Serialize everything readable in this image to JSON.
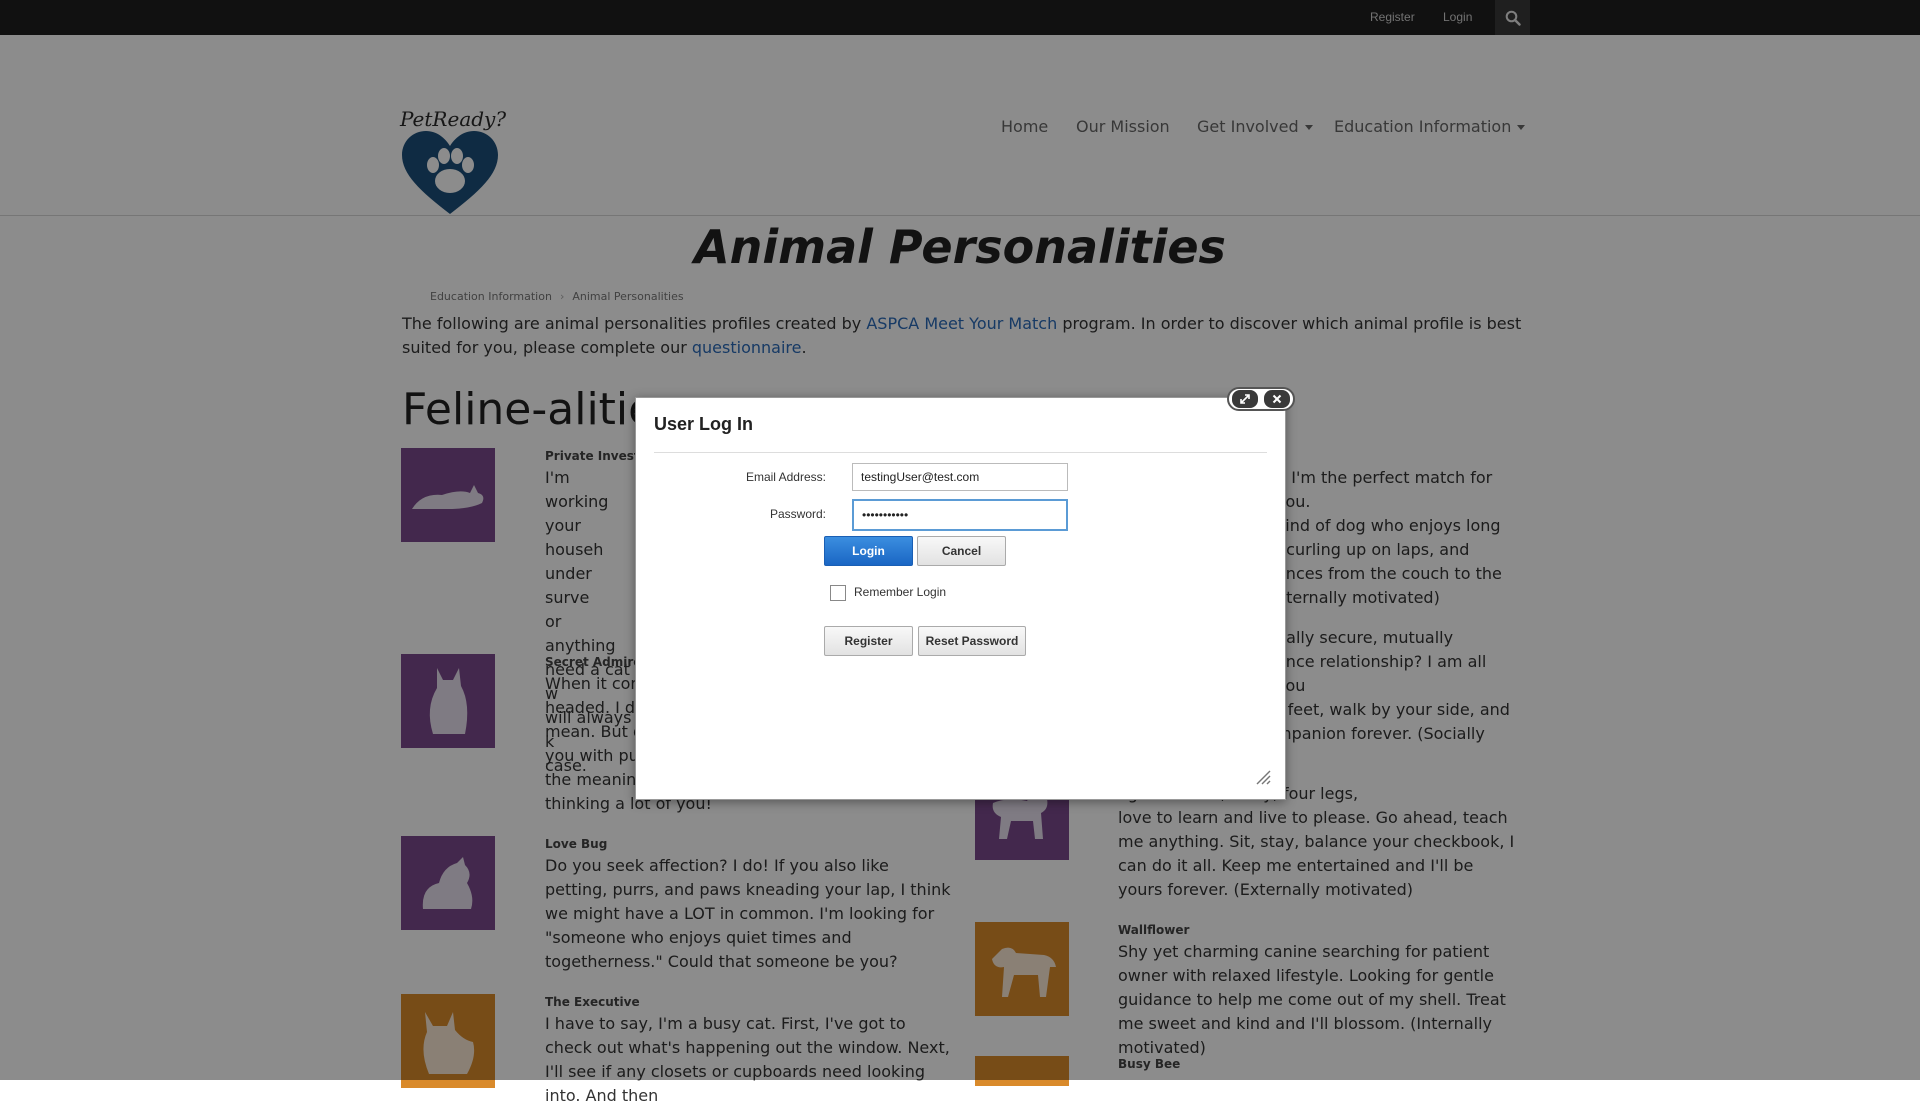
{
  "topbar": {
    "register": "Register",
    "login": "Login",
    "search_icon": "search-icon"
  },
  "header": {
    "logo_text": "PetReady?",
    "logo_icon": "heart-paw-icon",
    "nav": [
      {
        "label": "Home"
      },
      {
        "label": "Our Mission"
      },
      {
        "label": "Get Involved",
        "dropdown": true
      },
      {
        "label": "Education Information",
        "dropdown": true
      }
    ]
  },
  "page": {
    "title": "Animal Personalities",
    "breadcrumb": [
      "Education Information",
      "Animal Personalities"
    ],
    "intro_before": "The following are animal personalities profiles created by ",
    "intro_link1": "ASPCA Meet Your Match",
    "intro_mid": " program. In order to discover which animal profile is best suited for you, please complete our ",
    "intro_link2": "questionnaire",
    "intro_after": ".",
    "feline_title": "Feline-alities",
    "feline": [
      {
        "name": "Private Investig",
        "desc": "I'm working\nyour househ\nunder surve\nor anything\nneed a cat w\nwill always k\ncase."
      },
      {
        "name": "Secret Admirer",
        "desc": "When it com\nheaded. I do\nmean. But g\nyou with pu\nthe meanin\nthinking a lot of you!"
      },
      {
        "name": "Love Bug",
        "desc": "Do you seek affection? I do! If you also like petting, purrs, and paws kneading your lap, I think we might have a LOT in common. I'm looking for \"someone who enjoys quiet times and togetherness.\" Could that someone be you?"
      },
      {
        "name": "The Executive",
        "desc": "I have to say, I'm a busy cat. First, I've got to check out what's happening out the window. Next, I'll see if any closets or cupboards need looking into. And then"
      }
    ],
    "canine_partial": [
      {
        "desc": "n I'm the perfect match for you.\nkind of dog who enjoys long\n, curling up on laps, and\nances from the couch to the\nnternally motivated)"
      },
      {
        "desc": "nally secure, mutually\nance relationship? I am all you\nr feet, walk by your side, and\nmpanion forever. (Socially"
      },
      {
        "desc": "age — smart, fuzzy, four legs,\nlove to learn and live to please. Go ahead, teach me anything. Sit, stay, balance your checkbook, I can do it all. Keep me entertained and I'll be yours forever. (Externally motivated)"
      },
      {
        "name": "Wallflower",
        "desc": "Shy yet charming canine searching for patient owner with relaxed lifestyle. Looking for gentle guidance to help me come out of my shell. Treat me sweet and kind and I'll blossom. (Internally motivated)"
      },
      {
        "name": "Busy Bee",
        "desc": ""
      }
    ]
  },
  "dialog": {
    "title": "User Log In",
    "email_label": "Email Address:",
    "email_value": "testingUser@test.com",
    "password_label": "Password:",
    "password_value": "•••••••••••",
    "login_button": "Login",
    "cancel_button": "Cancel",
    "remember_label": "Remember Login",
    "remember_checked": false,
    "register_button": "Register",
    "reset_button": "Reset Password"
  },
  "colors": {
    "topbar": "#1f1f1f",
    "logo_heart": "#1d4f7a",
    "feline_tile": "#7b4a8c",
    "canine_tile": "#d98a2b",
    "primary_button": "#1a66c4",
    "link": "#2a6ab8"
  }
}
